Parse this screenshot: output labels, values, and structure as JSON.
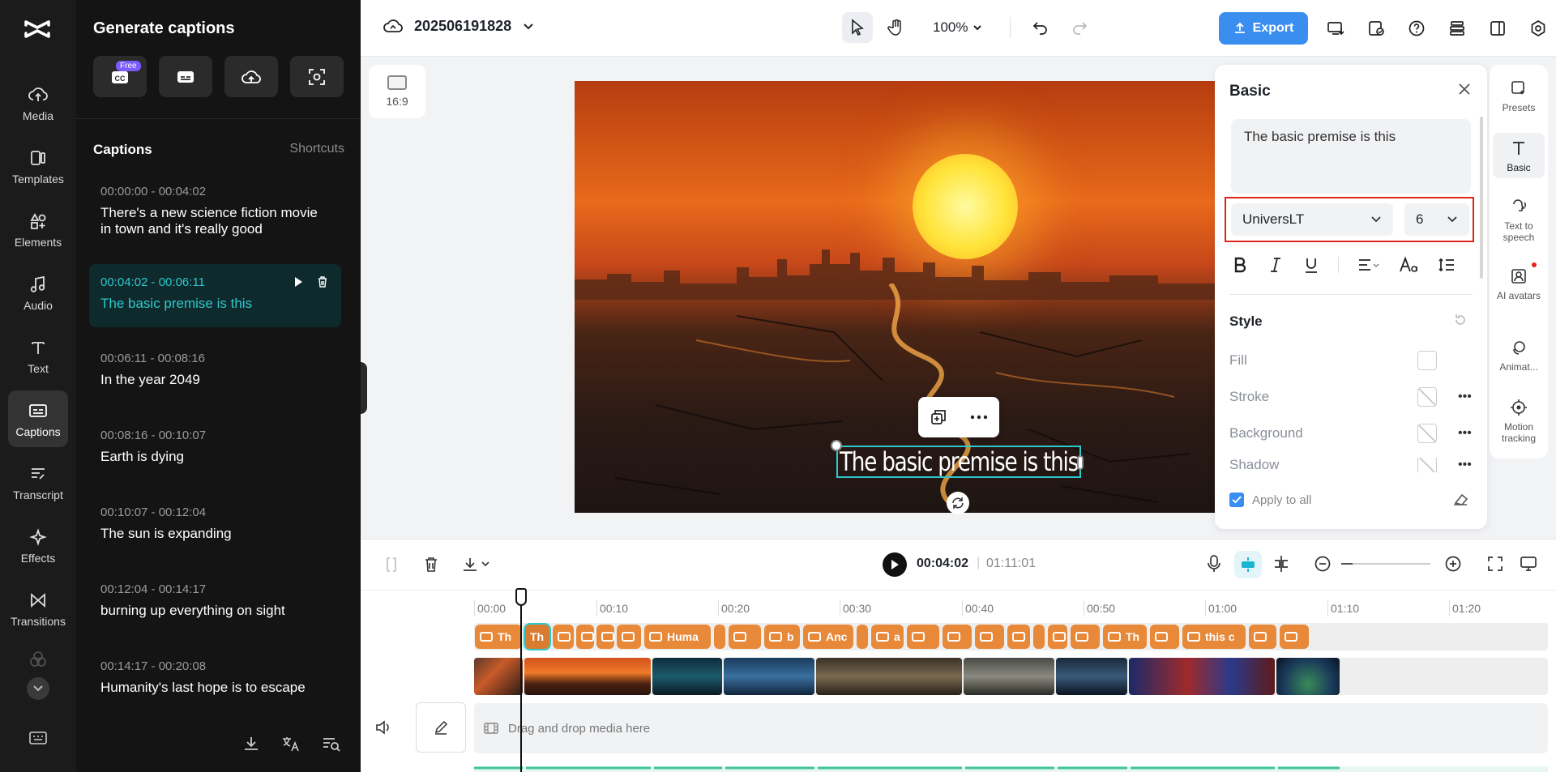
{
  "rail": {
    "items": [
      {
        "label": "Media",
        "icon": "cloud-upload-icon"
      },
      {
        "label": "Templates",
        "icon": "templates-icon"
      },
      {
        "label": "Elements",
        "icon": "elements-icon"
      },
      {
        "label": "Audio",
        "icon": "music-note-icon"
      },
      {
        "label": "Text",
        "icon": "text-icon"
      },
      {
        "label": "Captions",
        "icon": "captions-icon"
      },
      {
        "label": "Transcript",
        "icon": "transcript-icon"
      },
      {
        "label": "Effects",
        "icon": "effects-icon"
      },
      {
        "label": "Transitions",
        "icon": "transitions-icon"
      }
    ]
  },
  "captions_panel": {
    "title": "Generate captions",
    "free_badge": "Free",
    "section_label": "Captions",
    "shortcuts_label": "Shortcuts",
    "items": [
      {
        "time": "00:00:00 - 00:04:02",
        "text": "There's a new science fiction movie in town and it's really good"
      },
      {
        "time": "00:04:02 - 00:06:11",
        "text": "The basic premise is this"
      },
      {
        "time": "00:06:11 - 00:08:16",
        "text": "In the year 2049"
      },
      {
        "time": "00:08:16 - 00:10:07",
        "text": "Earth is dying"
      },
      {
        "time": "00:10:07 - 00:12:04",
        "text": "The sun is expanding"
      },
      {
        "time": "00:12:04 - 00:14:17",
        "text": "burning up everything on sight"
      },
      {
        "time": "00:14:17 - 00:20:08",
        "text": "Humanity's last hope is to escape"
      }
    ]
  },
  "topbar": {
    "project_name": "202506191828",
    "zoom": "100%",
    "export_label": "Export"
  },
  "canvas": {
    "ratio_label": "16:9",
    "caption_text": "The basic premise is this"
  },
  "basic_panel": {
    "title": "Basic",
    "text_value": "The basic premise is this",
    "font": "UniversLT",
    "font_size": "6",
    "style_title": "Style",
    "style_rows": [
      "Fill",
      "Stroke",
      "Background",
      "Shadow"
    ],
    "apply_to_all": "Apply to all"
  },
  "right_sidebar": {
    "items": [
      {
        "label": "Presets",
        "icon": "presets-icon"
      },
      {
        "label": "Basic",
        "icon": "text-t-icon"
      },
      {
        "label": "Text to speech",
        "icon": "text-to-speech-icon"
      },
      {
        "label": "AI avatars",
        "icon": "ai-avatar-icon"
      },
      {
        "label": "Animat...",
        "icon": "animation-icon"
      },
      {
        "label": "Motion tracking",
        "icon": "motion-tracking-icon"
      }
    ]
  },
  "timeline": {
    "current_time": "00:04:02",
    "total_time": "01:11:01",
    "ruler_ticks": [
      "00:00",
      "00:10",
      "00:20",
      "00:30",
      "00:40",
      "00:50",
      "01:00",
      "01:10",
      "01:20"
    ],
    "caption_chips": [
      "Th",
      "Th",
      "",
      "",
      "",
      "",
      "Huma",
      "",
      "",
      "b",
      "Anc",
      "",
      "a",
      "",
      "",
      "",
      "",
      "",
      "",
      "",
      "Th",
      "",
      "this c",
      "",
      ""
    ],
    "drop_hint": "Drag and drop media here"
  },
  "colors": {
    "accent": "#3a8ef0",
    "caption_active": "#2fc8cc",
    "chip": "#e8893a",
    "highlight_outline": "#e2231a"
  }
}
